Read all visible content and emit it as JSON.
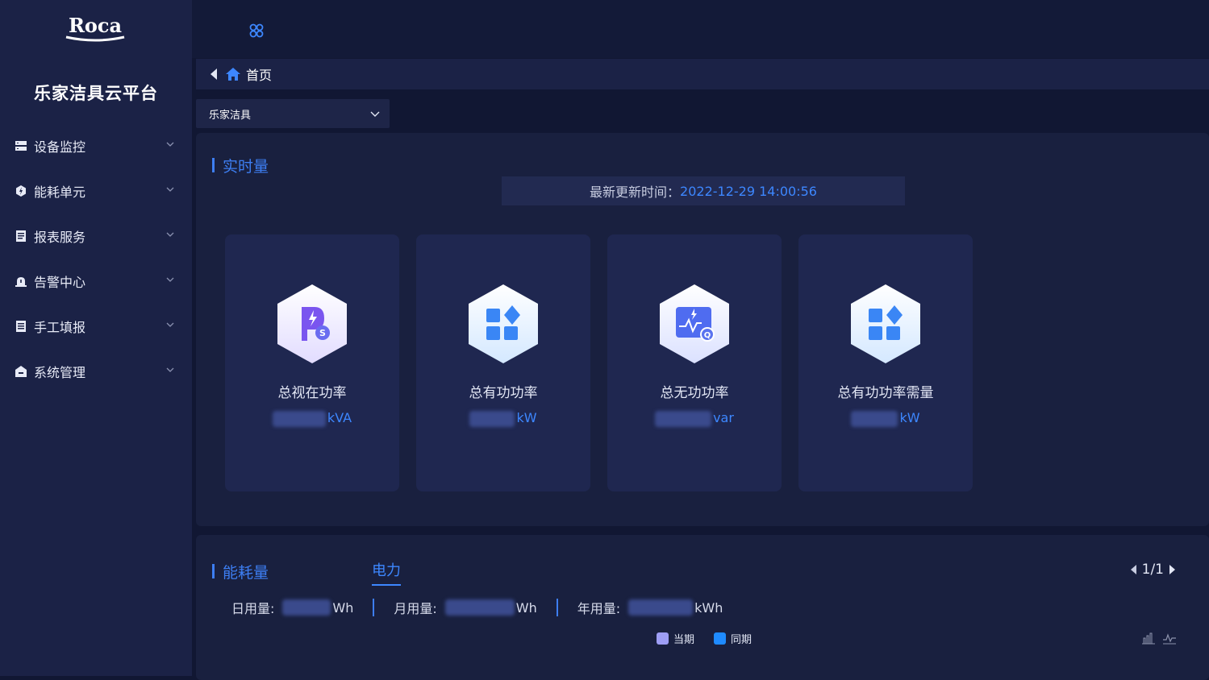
{
  "sidebar": {
    "logo_text": "Roca",
    "platform_title": "乐家洁具云平台",
    "items": [
      {
        "label": "设备监控",
        "icon": "server-icon"
      },
      {
        "label": "能耗单元",
        "icon": "energy-icon"
      },
      {
        "label": "报表服务",
        "icon": "report-icon"
      },
      {
        "label": "告警中心",
        "icon": "alarm-icon"
      },
      {
        "label": "手工填报",
        "icon": "manual-entry-icon"
      },
      {
        "label": "系统管理",
        "icon": "system-icon"
      }
    ]
  },
  "breadcrumb": {
    "home_label": "首页"
  },
  "site_select": {
    "value": "乐家洁具"
  },
  "realtime": {
    "title": "实时量",
    "update_label": "最新更新时间：",
    "update_time": "2022-12-29 14:00:56",
    "metrics": [
      {
        "name": "总视在功率",
        "unit": "kVA",
        "icon": "apparent-power-icon"
      },
      {
        "name": "总有功功率",
        "unit": "kW",
        "icon": "active-power-icon"
      },
      {
        "name": "总无功功率",
        "unit": "var",
        "icon": "reactive-power-icon"
      },
      {
        "name": "总有功功率需量",
        "unit": "kW",
        "icon": "active-power-demand-icon"
      }
    ]
  },
  "energy": {
    "title": "能耗量",
    "tab": "电力",
    "pager": "1/1",
    "usage": [
      {
        "label": "日用量:",
        "unit": "Wh"
      },
      {
        "label": "月用量:",
        "unit": "Wh"
      },
      {
        "label": "年用量:",
        "unit": "kWh"
      }
    ],
    "legend": [
      {
        "name": "当期",
        "color": "#9e9ef5"
      },
      {
        "name": "同期",
        "color": "#1f8bff"
      }
    ]
  },
  "colors": {
    "accent": "#3d87ff",
    "sidebar_bg": "#1b2246",
    "page_bg": "#111733"
  }
}
